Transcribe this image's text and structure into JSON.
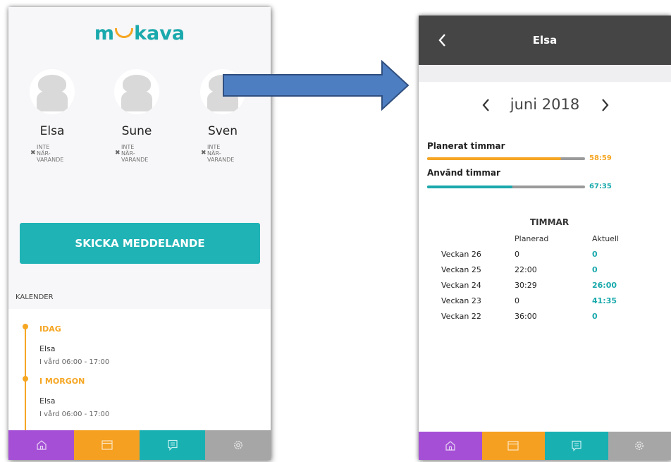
{
  "left": {
    "logo": {
      "part1": "m",
      "part2": "kava"
    },
    "children": [
      {
        "name": "Elsa",
        "status_l1": "INTE",
        "status_l2": "NÄR-",
        "status_l3": "VARANDE"
      },
      {
        "name": "Sune",
        "status_l1": "INTE",
        "status_l2": "NÄR-",
        "status_l3": "VARANDE"
      },
      {
        "name": "Sven",
        "status_l1": "INTE",
        "status_l2": "NÄR-",
        "status_l3": "VARANDE"
      }
    ],
    "send_button": "SKICKA MEDDELANDE",
    "calendar_label": "KALENDER",
    "events": [
      {
        "day": "IDAG",
        "name": "Elsa",
        "desc": "I vård  06:00 - 17:00"
      },
      {
        "day": "I MORGON",
        "name": "Elsa",
        "desc": "I vård  06:00 - 17:00"
      }
    ]
  },
  "right": {
    "title": "Elsa",
    "month": "juni 2018",
    "planned": {
      "label": "Planerat timmar",
      "value": "58:59",
      "fraction": 0.85
    },
    "used": {
      "label": "Använd timmar",
      "value": "67:35",
      "fraction": 0.54
    },
    "table": {
      "title": "TIMMAR",
      "col_planned": "Planerad",
      "col_actual": "Aktuell",
      "rows": [
        {
          "week": "Veckan 26",
          "planned": "0",
          "actual": "0"
        },
        {
          "week": "Veckan 25",
          "planned": "22:00",
          "actual": "0"
        },
        {
          "week": "Veckan 24",
          "planned": "30:29",
          "actual": "26:00"
        },
        {
          "week": "Veckan 23",
          "planned": "0",
          "actual": "41:35"
        },
        {
          "week": "Veckan 22",
          "planned": "36:00",
          "actual": "0"
        }
      ]
    }
  },
  "colors": {
    "teal": "#1aa9ac",
    "orange": "#f5a623",
    "purple": "#a54fd6",
    "gray": "#a6a6a6",
    "topbar": "#454545"
  },
  "icons": [
    "home-icon",
    "calendar-icon",
    "message-icon",
    "gear-icon",
    "chevron-left-icon",
    "chevron-right-icon",
    "arrow-right-icon"
  ]
}
